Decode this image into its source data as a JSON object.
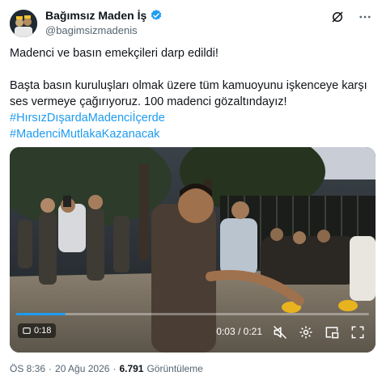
{
  "author": {
    "display_name": "Bağımsız Maden İş",
    "handle": "@bagimsizmadenis",
    "verified": true
  },
  "tweet": {
    "line1": "Madenci ve basın emekçileri darp edildi!",
    "line2": "Başta basın kuruluşları olmak üzere tüm kamuoyunu işkenceye karşı ses vermeye çağırıyoruz. 100 madenci gözaltındayız!",
    "hashtags": [
      "#HırsızDışardaMadenciİçerde",
      "#MadenciMutlakaKazanacak"
    ]
  },
  "video": {
    "duration_badge": "0:18",
    "time_label": "0:03 / 0:21",
    "progress": 0.14
  },
  "meta": {
    "time": "ÖS 8:36",
    "date": "20 Ağu 2026",
    "separator": "·",
    "views": "6.791",
    "views_label": "Görüntüleme"
  },
  "icons": [
    "verified-badge-icon",
    "grok-icon",
    "more-icon",
    "mute-icon",
    "settings-icon",
    "pip-icon",
    "fullscreen-icon"
  ],
  "colors": {
    "link": "#1d9bf0",
    "text": "#0f1419",
    "muted": "#536471"
  }
}
